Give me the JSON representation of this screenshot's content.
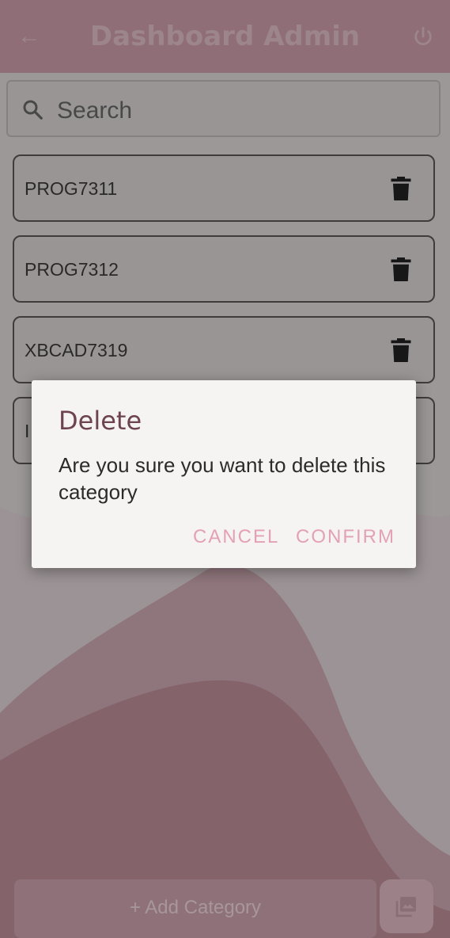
{
  "appbar": {
    "title": "Dashboard Admin"
  },
  "search": {
    "placeholder": "Search"
  },
  "categories": [
    {
      "name": "PROG7311"
    },
    {
      "name": "PROG7312"
    },
    {
      "name": "XBCAD7319"
    },
    {
      "name": "I"
    }
  ],
  "footer": {
    "add_label": "+ Add Category"
  },
  "dialog": {
    "title": "Delete",
    "message": "Are you sure you want to delete this category",
    "cancel_label": "CANCEL",
    "confirm_label": "CONFIRM"
  },
  "colors": {
    "accent": "#e3a2b3",
    "dialog_title": "#6d4351",
    "appbar": "#b88a96"
  }
}
